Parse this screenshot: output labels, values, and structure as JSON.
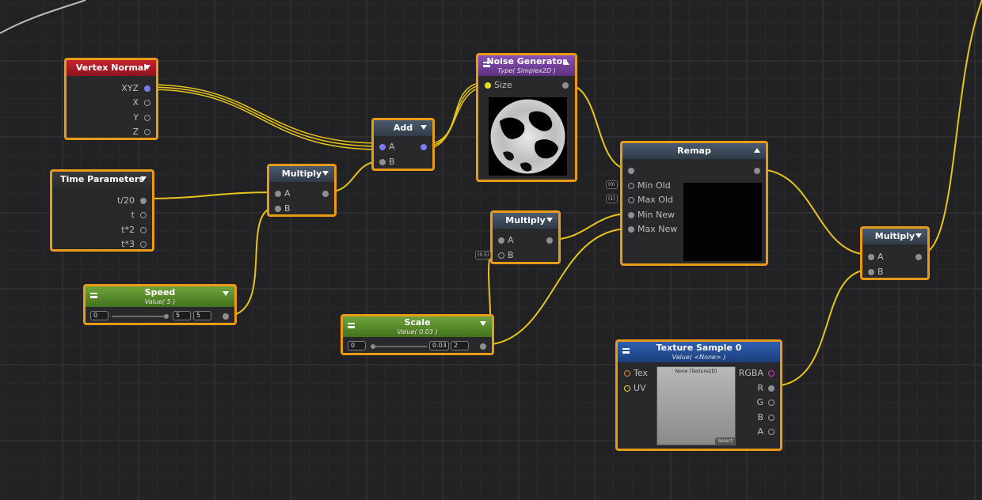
{
  "colors": {
    "wire": "#e6c41e",
    "highlight": "#e79b17",
    "grid": "#222224"
  },
  "nodes": {
    "vertex_normal": {
      "title": "Vertex Normal",
      "ports": [
        "XYZ",
        "X",
        "Y",
        "Z"
      ]
    },
    "time_parameters": {
      "title": "Time Parameters",
      "ports": [
        "t/20",
        "t",
        "t*2",
        "t*3"
      ]
    },
    "add": {
      "title": "Add",
      "inputs": [
        "A",
        "B"
      ]
    },
    "multiply1": {
      "title": "Multiply",
      "inputs": [
        "A",
        "B"
      ]
    },
    "multiply2": {
      "title": "Multiply",
      "inputs": [
        "A",
        "B"
      ],
      "badge": "(0.5)"
    },
    "multiply3": {
      "title": "Multiply",
      "inputs": [
        "A",
        "B"
      ]
    },
    "noise": {
      "title": "Noise Generator",
      "subtitle": "Type( Simplex2D )",
      "inputs": [
        "Size"
      ]
    },
    "remap": {
      "title": "Remap",
      "inputs": [
        "Min Old",
        "Max Old",
        "Min New",
        "Max New"
      ],
      "badges": [
        "(0)",
        "(1)"
      ]
    },
    "speed": {
      "title": "Speed",
      "subtitle": "Value( 5 )",
      "min": "0",
      "value": "5",
      "max": "5",
      "slider_fraction": 1.0
    },
    "scale": {
      "title": "Scale",
      "subtitle": "Value( 0.03 )",
      "min": "0",
      "value": "0.03",
      "max": "2",
      "slider_fraction": 0.015
    },
    "texture": {
      "title": "Texture Sample 0",
      "subtitle": "Value( <None> )",
      "inputs": [
        "Tex",
        "UV"
      ],
      "outputs": [
        "RGBA",
        "R",
        "G",
        "B",
        "A"
      ],
      "texture_label": "None (Texture2D)",
      "select_label": "Select"
    }
  }
}
